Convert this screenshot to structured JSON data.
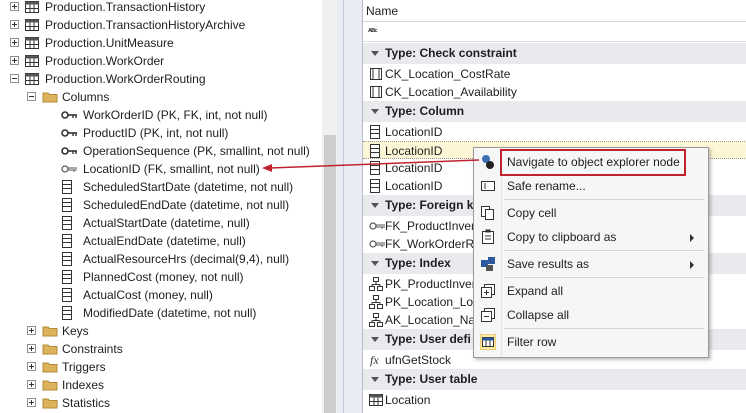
{
  "tree": {
    "items": [
      {
        "label": "Production.TransactionHistory",
        "indent": 0,
        "expander": "plus",
        "icon": "table-icon"
      },
      {
        "label": "Production.TransactionHistoryArchive",
        "indent": 0,
        "expander": "plus",
        "icon": "table-icon"
      },
      {
        "label": "Production.UnitMeasure",
        "indent": 0,
        "expander": "plus",
        "icon": "table-icon"
      },
      {
        "label": "Production.WorkOrder",
        "indent": 0,
        "expander": "plus",
        "icon": "table-icon"
      },
      {
        "label": "Production.WorkOrderRouting",
        "indent": 0,
        "expander": "minus",
        "icon": "table-icon"
      },
      {
        "label": "Columns",
        "indent": 1,
        "expander": "minus",
        "icon": "folder-icon"
      },
      {
        "label": "WorkOrderID (PK, FK, int, not null)",
        "indent": 2,
        "icon": "key-icon"
      },
      {
        "label": "ProductID (PK, int, not null)",
        "indent": 2,
        "icon": "key-icon"
      },
      {
        "label": "OperationSequence (PK, smallint, not null)",
        "indent": 2,
        "icon": "key-icon"
      },
      {
        "label": "LocationID (FK, smallint, not null)",
        "indent": 2,
        "icon": "foreign-key-icon"
      },
      {
        "label": "ScheduledStartDate (datetime, not null)",
        "indent": 2,
        "icon": "column-icon"
      },
      {
        "label": "ScheduledEndDate (datetime, not null)",
        "indent": 2,
        "icon": "column-icon"
      },
      {
        "label": "ActualStartDate (datetime, null)",
        "indent": 2,
        "icon": "column-icon"
      },
      {
        "label": "ActualEndDate (datetime, null)",
        "indent": 2,
        "icon": "column-icon"
      },
      {
        "label": "ActualResourceHrs (decimal(9,4), null)",
        "indent": 2,
        "icon": "column-icon"
      },
      {
        "label": "PlannedCost (money, not null)",
        "indent": 2,
        "icon": "column-icon"
      },
      {
        "label": "ActualCost (money, null)",
        "indent": 2,
        "icon": "column-icon"
      },
      {
        "label": "ModifiedDate (datetime, not null)",
        "indent": 2,
        "icon": "column-icon"
      },
      {
        "label": "Keys",
        "indent": 1,
        "expander": "plus",
        "icon": "folder-icon"
      },
      {
        "label": "Constraints",
        "indent": 1,
        "expander": "plus",
        "icon": "folder-icon"
      },
      {
        "label": "Triggers",
        "indent": 1,
        "expander": "plus",
        "icon": "folder-icon"
      },
      {
        "label": "Indexes",
        "indent": 1,
        "expander": "plus",
        "icon": "folder-icon"
      },
      {
        "label": "Statistics",
        "indent": 1,
        "expander": "plus",
        "icon": "folder-icon"
      }
    ]
  },
  "grid": {
    "header": "Name",
    "rows": [
      {
        "kind": "group",
        "label": "Type: Check constraint"
      },
      {
        "kind": "item",
        "label": "CK_Location_CostRate",
        "icon": "check-constraint-icon"
      },
      {
        "kind": "item",
        "label": "CK_Location_Availability",
        "icon": "check-constraint-icon"
      },
      {
        "kind": "group",
        "label": "Type: Column"
      },
      {
        "kind": "item",
        "label": "LocationID",
        "icon": "column-icon"
      },
      {
        "kind": "item",
        "label": "LocationID",
        "icon": "column-icon",
        "selected": true
      },
      {
        "kind": "item",
        "label": "LocationID",
        "icon": "column-icon"
      },
      {
        "kind": "item",
        "label": "LocationID",
        "icon": "column-icon"
      },
      {
        "kind": "group",
        "label": "Type: Foreign k"
      },
      {
        "kind": "item",
        "label": "FK_ProductInvent",
        "icon": "foreign-key-icon"
      },
      {
        "kind": "item",
        "label": "FK_WorkOrderRou",
        "icon": "foreign-key-icon"
      },
      {
        "kind": "group",
        "label": "Type: Index"
      },
      {
        "kind": "item",
        "label": "PK_ProductInvent",
        "icon": "index-icon"
      },
      {
        "kind": "item",
        "label": "PK_Location_Loca",
        "icon": "index-icon"
      },
      {
        "kind": "item",
        "label": "AK_Location_Nam",
        "icon": "index-icon"
      },
      {
        "kind": "group",
        "label": "Type: User defi"
      },
      {
        "kind": "item",
        "label": "ufnGetStock",
        "icon": "function-icon"
      },
      {
        "kind": "group",
        "label": "Type: User table"
      },
      {
        "kind": "item",
        "label": "Location",
        "icon": "table-icon"
      }
    ]
  },
  "menu": {
    "items": [
      {
        "label": "Navigate to object explorer node",
        "icon": "navigate-icon",
        "highlighted": true
      },
      {
        "label": "Safe rename...",
        "icon": "rename-icon"
      },
      {
        "separator": true
      },
      {
        "label": "Copy cell",
        "icon": "copy-icon"
      },
      {
        "label": "Copy to clipboard as",
        "icon": "clipboard-icon",
        "submenu": true
      },
      {
        "separator": true
      },
      {
        "label": "Save results as",
        "icon": "save-icon",
        "submenu": true
      },
      {
        "separator": true
      },
      {
        "label": "Expand all",
        "icon": "expand-all-icon"
      },
      {
        "label": "Collapse all",
        "icon": "collapse-all-icon"
      },
      {
        "separator": true
      },
      {
        "label": "Filter row",
        "icon": "filter-row-icon"
      }
    ]
  },
  "colors": {
    "highlight_border": "#c0222e",
    "folder": "#dcb35c",
    "group_bg": "#e8eaee",
    "selected_row_bg": "#fdf6d6"
  }
}
